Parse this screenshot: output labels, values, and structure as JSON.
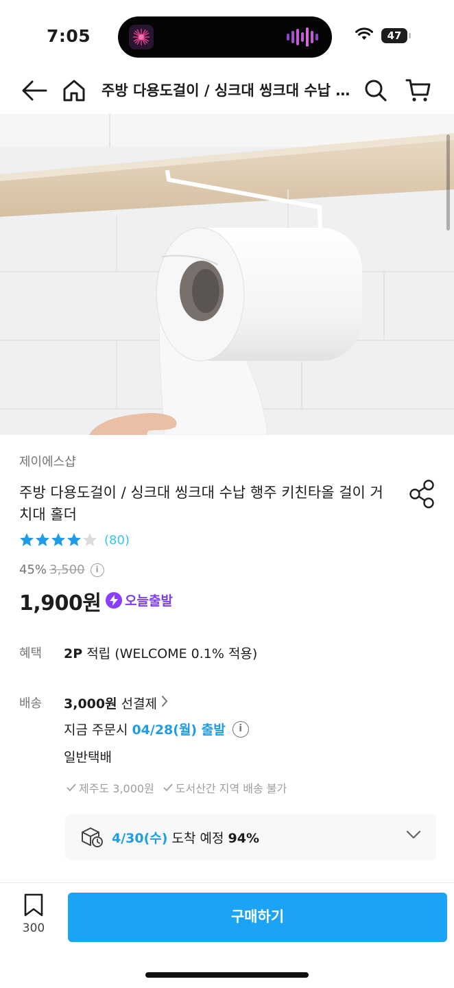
{
  "status_bar": {
    "time": "7:05",
    "battery": "47"
  },
  "nav": {
    "title": "주방 다용도걸이 / 싱크대 씽크대 수납 행주 키친타올 걸이 거치대 홀더",
    "back_icon": "arrow-left-icon",
    "home_icon": "home-icon",
    "search_icon": "search-icon",
    "cart_icon": "cart-icon"
  },
  "product": {
    "brand": "제이에스샵",
    "title": "주방 다용도걸이 / 싱크대 씽크대 수납 행주 키친타올 걸이 거치대 홀더",
    "rating_stars": 4.5,
    "review_count": "(80)",
    "discount": "45%",
    "original_price": "3,500",
    "price": "1,900원",
    "today_ship_label": "오늘출발"
  },
  "benefit": {
    "label": "혜택",
    "points": "2P",
    "text": " 적립 (WELCOME 0.1% 적용)"
  },
  "shipping": {
    "label": "배송",
    "fee": "3,000원",
    "fee_type": "선결제",
    "order_prefix": "지금 주문시",
    "ship_date": "04/28(월) 출발",
    "method": "일반택배",
    "notes": [
      "제주도 3,000원",
      "도서산간 지역 배송 불가"
    ],
    "arrival_date": "4/30(수)",
    "arrival_text": " 도착 예정 ",
    "arrival_pct": "94%"
  },
  "bottom_bar": {
    "scrap_count": "300",
    "buy_label": "구매하기"
  },
  "colors": {
    "accent": "#1ba4f5",
    "link_blue": "#35c5f0",
    "today_purple": "#7b3ff2",
    "star": "#1e9de6"
  }
}
